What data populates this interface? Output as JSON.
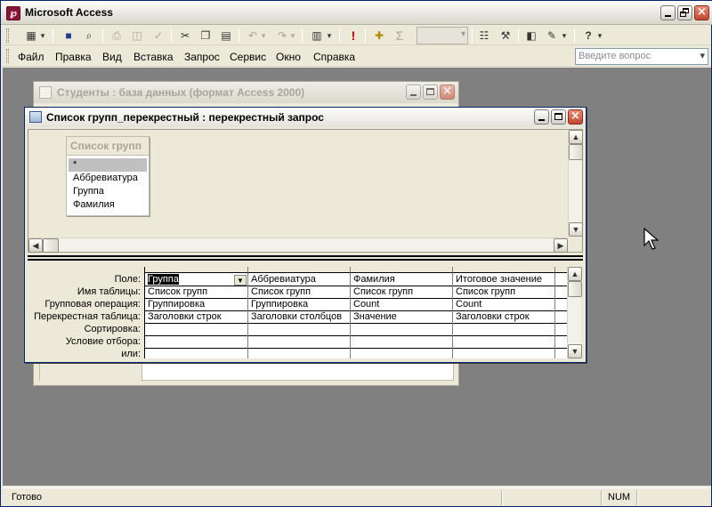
{
  "app": {
    "title": "Microsoft Access",
    "icon": "access-key-icon"
  },
  "toolbar": {
    "icons": [
      "view-icon",
      "dropdown-arrow-icon",
      "save-icon",
      "search-file-icon",
      "print-icon",
      "print-preview-icon",
      "spelling-icon",
      "cut-icon",
      "copy-icon",
      "paste-icon",
      "undo-icon",
      "redo-icon",
      "query-type-icon",
      "run-icon",
      "show-table-icon",
      "totals-icon",
      "top-values-combo",
      "properties-icon",
      "build-icon",
      "database-window-icon",
      "new-object-icon",
      "help-icon"
    ]
  },
  "menu": {
    "items": [
      {
        "label": "Файл",
        "key": "file"
      },
      {
        "label": "Правка",
        "key": "edit"
      },
      {
        "label": "Вид",
        "key": "view"
      },
      {
        "label": "Вставка",
        "key": "insert"
      },
      {
        "label": "Запрос",
        "key": "query"
      },
      {
        "label": "Сервис",
        "key": "tools"
      },
      {
        "label": "Окно",
        "key": "window"
      },
      {
        "label": "Справка",
        "key": "help"
      }
    ],
    "ask_placeholder": "Введите вопрос"
  },
  "db_window": {
    "title": "Студенты : база данных (формат Access 2000)"
  },
  "query_window": {
    "title": "Список групп_перекрестный : перекрестный запрос",
    "table": {
      "name": "Список групп",
      "fields": [
        "*",
        "Аббревиатура",
        "Группа",
        "Фамилия"
      ]
    },
    "row_labels": [
      "Поле:",
      "Имя таблицы:",
      "Групповая операция:",
      "Перекрестная таблица:",
      "Сортировка:",
      "Условие отбора:",
      "или:"
    ],
    "columns": [
      {
        "field": "Группа",
        "table": "Список групп",
        "total": "Группировка",
        "crosstab": "Заголовки строк",
        "sort": "",
        "criteria": "",
        "or": ""
      },
      {
        "field": "Аббревиатура",
        "table": "Список групп",
        "total": "Группировка",
        "crosstab": "Заголовки столбцов",
        "sort": "",
        "criteria": "",
        "or": ""
      },
      {
        "field": "Фамилия",
        "table": "Список групп",
        "total": "Count",
        "crosstab": "Значение",
        "sort": "",
        "criteria": "",
        "or": ""
      },
      {
        "field": "Итоговое значение",
        "table": "Список групп",
        "total": "Count",
        "crosstab": "Заголовки строк",
        "sort": "",
        "criteria": "",
        "or": ""
      }
    ]
  },
  "status": {
    "text": "Готово",
    "num": "NUM"
  }
}
